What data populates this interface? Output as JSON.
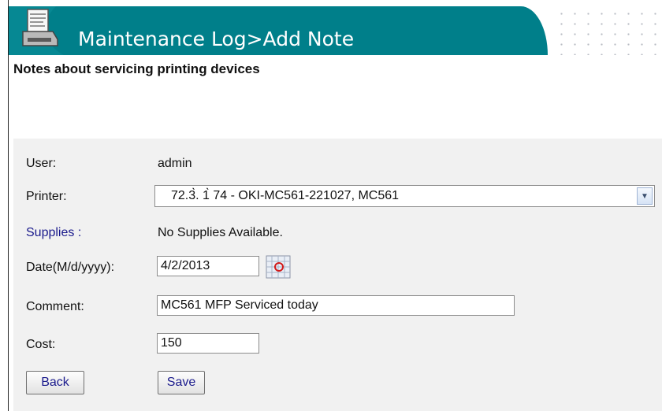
{
  "header": {
    "title": "Maintenance Log>Add Note",
    "icon": "printer-notepad-icon",
    "banner_color": "#007f8a"
  },
  "subtitle": "Notes about servicing printing devices",
  "form": {
    "user": {
      "label": "User:",
      "value": "admin"
    },
    "printer": {
      "label": "Printer:",
      "selected": "72.3̀. 1̀ 74 - OKI-MC561-221027, MC561"
    },
    "supplies": {
      "label": "Supplies :",
      "value": "No Supplies Available."
    },
    "date": {
      "label": "Date(M/d/yyyy):",
      "value": "4/2/2013"
    },
    "comment": {
      "label": "Comment:",
      "value": "MC561 MFP Serviced today"
    },
    "cost": {
      "label": "Cost:",
      "value": "150"
    }
  },
  "buttons": {
    "back": "Back",
    "save": "Save"
  }
}
